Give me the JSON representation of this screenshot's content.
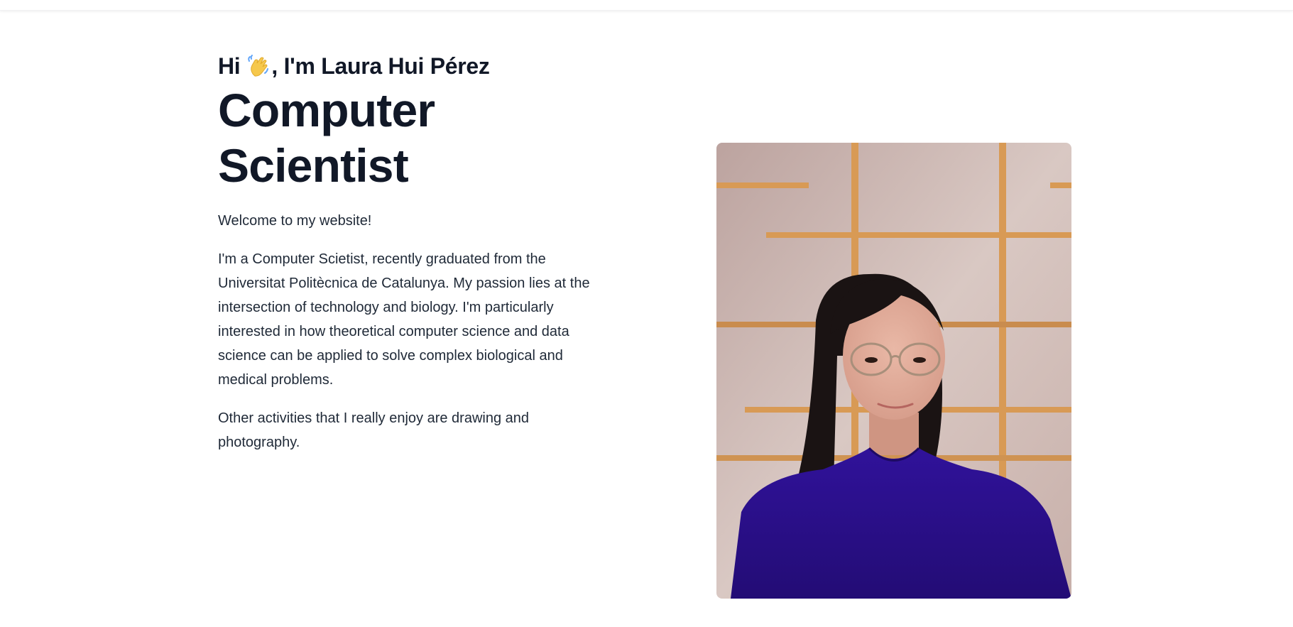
{
  "header": {},
  "hero": {
    "greeting_prefix": "Hi",
    "greeting_emoji": "waving-hand-icon",
    "greeting_suffix": ", I'm Laura Hui Pérez",
    "role": "Computer Scientist",
    "paragraphs": [
      "Welcome to my website!",
      "I'm a Computer Scietist, recently graduated from the Universitat Politècnica de Catalunya. My passion lies at the intersection of technology and biology. I'm particularly interested in how theoretical computer science and data science can be applied to solve complex biological and medical problems.",
      "Other activities that I really enjoy are drawing and photography."
    ]
  },
  "colors": {
    "text": "#111827",
    "body_text": "#1f2937",
    "background": "#ffffff",
    "shirt": "#2a0f88",
    "wall": "#cdb7b3",
    "wood": "#d89a55"
  }
}
